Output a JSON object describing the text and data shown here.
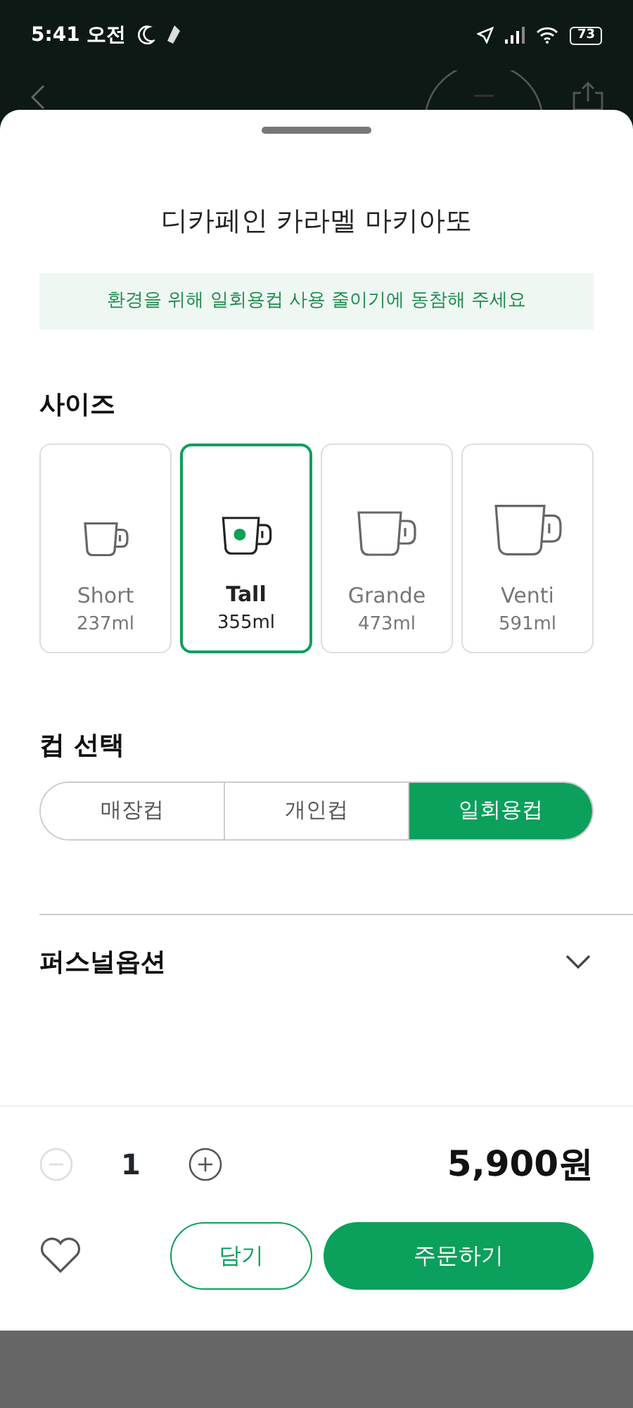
{
  "status_bar": {
    "time": "5:41 오전",
    "battery": "73"
  },
  "sheet": {
    "title": "디카페인 카라멜 마키아또",
    "notice": "환경을 위해 일회용컵 사용 줄이기에 동참해 주세요"
  },
  "size_section": {
    "heading": "사이즈",
    "options": [
      {
        "name": "Short",
        "volume": "237ml",
        "selected": false
      },
      {
        "name": "Tall",
        "volume": "355ml",
        "selected": true
      },
      {
        "name": "Grande",
        "volume": "473ml",
        "selected": false
      },
      {
        "name": "Venti",
        "volume": "591ml",
        "selected": false
      }
    ]
  },
  "cup_section": {
    "heading": "컵 선택",
    "options": [
      {
        "label": "매장컵",
        "selected": false
      },
      {
        "label": "개인컵",
        "selected": false
      },
      {
        "label": "일회용컵",
        "selected": true
      }
    ]
  },
  "personal_option": {
    "label": "퍼스널옵션",
    "expanded": false
  },
  "quantity": {
    "value": "1",
    "minus_disabled": true,
    "plus_disabled": false
  },
  "price": "5,900원",
  "buttons": {
    "favorite": false,
    "cart": "담기",
    "order": "주문하기"
  }
}
